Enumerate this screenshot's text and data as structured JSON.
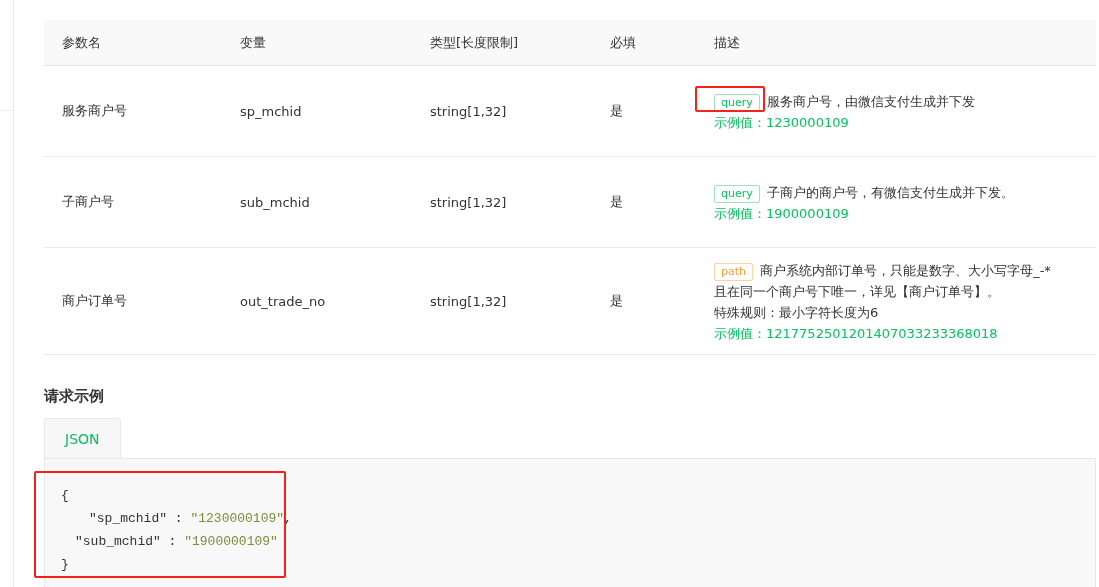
{
  "table": {
    "columns": [
      "参数名",
      "变量",
      "类型[长度限制]",
      "必填",
      "描述"
    ],
    "rows": [
      {
        "name": "服务商户号",
        "variable": "sp_mchid",
        "type": "string[1,32]",
        "required": "是",
        "tag": {
          "label": "query",
          "kind": "query",
          "highlighted": true
        },
        "description": [
          "服务商户号，由微信支付生成并下发"
        ],
        "example": "示例值：1230000109"
      },
      {
        "name": "子商户号",
        "variable": "sub_mchid",
        "type": "string[1,32]",
        "required": "是",
        "tag": {
          "label": "query",
          "kind": "query",
          "highlighted": false
        },
        "description": [
          "子商户的商户号，有微信支付生成并下发。"
        ],
        "example": "示例值：1900000109"
      },
      {
        "name": "商户订单号",
        "variable": "out_trade_no",
        "type": "string[1,32]",
        "required": "是",
        "tag": {
          "label": "path",
          "kind": "path",
          "highlighted": false
        },
        "description": [
          "商户系统内部订单号，只能是数字、大小写字母_-*",
          "且在同一个商户号下唯一，详见【商户订单号】。",
          "特殊规则：最小字符长度为6"
        ],
        "example": "示例值：1217752501201407033233368018"
      }
    ]
  },
  "example_section": {
    "title": "请求示例",
    "tabs": [
      {
        "label": "JSON",
        "selected": true
      }
    ],
    "code": {
      "highlighted": true,
      "lines": [
        [
          {
            "kind": "punct",
            "text": "{"
          }
        ],
        [
          {
            "kind": "key",
            "text": "″sp_mchid″ : "
          },
          {
            "kind": "string",
            "text": "″1230000109″"
          },
          {
            "kind": "punct",
            "text": ","
          }
        ],
        [
          {
            "kind": "key",
            "text": "″sub_mchid″ : "
          },
          {
            "kind": "string",
            "text": "″1900000109″"
          }
        ],
        [
          {
            "kind": "punct",
            "text": "}"
          }
        ]
      ]
    }
  }
}
